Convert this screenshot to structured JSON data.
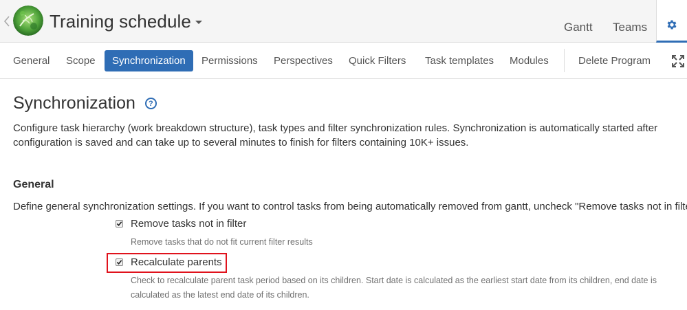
{
  "header": {
    "title": "Training schedule",
    "tabs": [
      {
        "label": "Gantt"
      },
      {
        "label": "Teams"
      }
    ],
    "settings_icon": "gear-icon",
    "back_icon": "chevron-left-icon",
    "accent_color": "#2f6db5"
  },
  "subnav": {
    "items": [
      {
        "label": "General"
      },
      {
        "label": "Scope"
      },
      {
        "label": "Synchronization",
        "active": true
      },
      {
        "label": "Permissions"
      },
      {
        "label": "Perspectives"
      },
      {
        "label": "Quick Filters"
      },
      {
        "label": "Task templates"
      },
      {
        "label": "Modules"
      },
      {
        "label": "Delete Program"
      }
    ],
    "expand_icon": "expand-icon"
  },
  "page": {
    "title": "Synchronization",
    "help_glyph": "?",
    "description": "Configure task hierarchy (work breakdown structure), task types and filter synchronization rules. Synchronization is automatically started after configuration is saved and can take up to several minutes to finish for filters containing 10K+ issues."
  },
  "general": {
    "title": "General",
    "description": "Define general synchronization settings. If you want to control tasks from being automatically removed from gantt, uncheck \"Remove tasks not in filter\"",
    "options": [
      {
        "label": "Remove tasks not in filter",
        "checked": true,
        "hint": "Remove tasks that do not fit current filter results"
      },
      {
        "label": "Recalculate parents",
        "checked": true,
        "hint": "Check to recalculate parent task period based on its children. Start date is calculated as the earliest start date from its children, end date is calculated as the latest end date of its children."
      }
    ],
    "highlight_color": "#e0121c"
  }
}
